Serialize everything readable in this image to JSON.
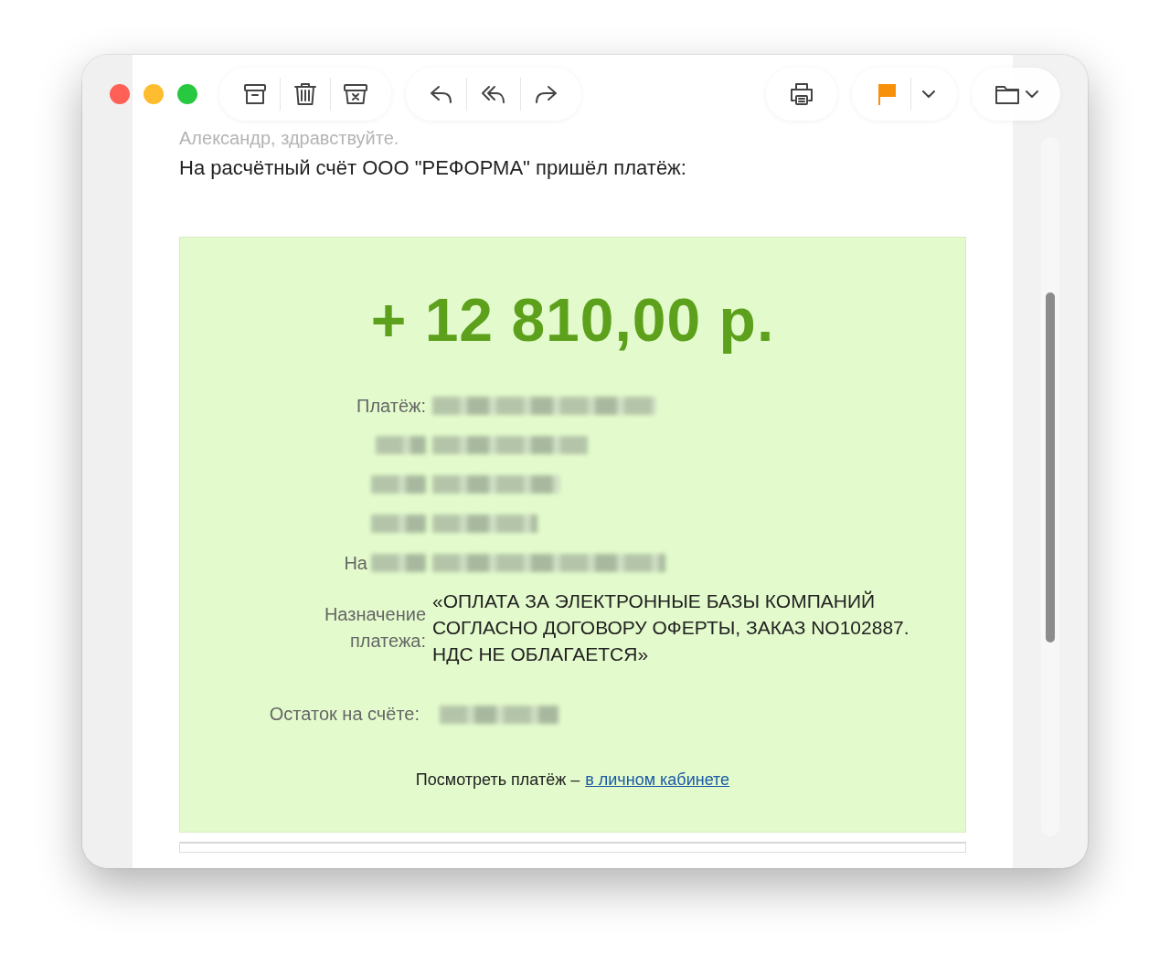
{
  "window": {
    "toolbar": {
      "groups": [
        {
          "buttons": [
            {
              "kind": "archive"
            },
            {
              "kind": "trash"
            },
            {
              "kind": "junk"
            }
          ]
        },
        {
          "buttons": [
            {
              "kind": "reply"
            },
            {
              "kind": "reply_all"
            },
            {
              "kind": "forward"
            }
          ]
        },
        {
          "buttons": [
            {
              "kind": "print"
            }
          ]
        },
        {
          "buttons": [
            {
              "kind": "flag"
            },
            {
              "kind": "chevron"
            }
          ]
        },
        {
          "buttons": [
            {
              "kind": "folder"
            }
          ]
        }
      ]
    }
  },
  "message": {
    "greeting": "Александр, здравствуйте.",
    "intro": "На расчётный счёт ООО \"РЕФОРМА\" пришёл платёж:",
    "notice": {
      "amount": "+ 12 810,00 р.",
      "rows": [
        {
          "kind": "hidden",
          "label": "Платёж:"
        },
        {
          "kind": "hidden",
          "label_hidden": true
        },
        {
          "kind": "hidden",
          "label_hidden": true
        },
        {
          "kind": "hidden",
          "label_hidden": true
        },
        {
          "kind": "hidden",
          "label": "На",
          "label_hidden": true
        },
        {
          "kind": "text",
          "label": "Назначение платежа:",
          "value": "«ОПЛАТА ЗА ЭЛЕКТРОННЫЕ БАЗЫ КОМПАНИЙ СОГЛАСНО ДОГОВОРУ ОФЕРТЫ, ЗАКАЗ NO102887. НДС НЕ ОБЛАГАЕТСЯ»"
        }
      ],
      "balance": {
        "label": "Остаток на счёте:",
        "hidden": true
      },
      "view_text": "Посмотреть платёж –",
      "view_link": "в личном кабинете"
    }
  }
}
